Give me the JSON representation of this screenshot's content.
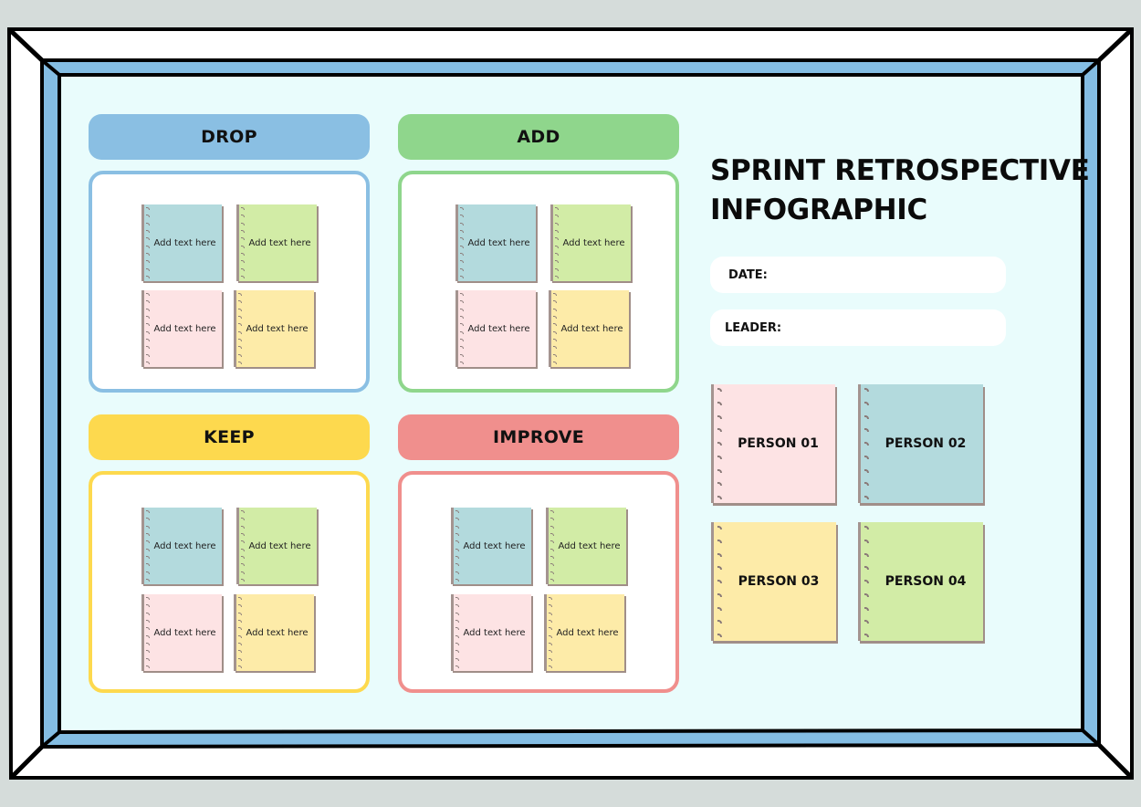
{
  "colors": {
    "background": "#d5dcda",
    "board": "#e9fcfc",
    "frame_blue": "#84bde3",
    "drop": "#8abfe3",
    "add": "#8fd68c",
    "keep": "#fdd94e",
    "improve": "#f08f8d"
  },
  "title": {
    "line1": "SPRINT RETROSPECTIVE",
    "line2": "INFOGRAPHIC"
  },
  "fields": {
    "date_label": "DATE:",
    "leader_label": "LEADER:"
  },
  "sections": [
    {
      "key": "drop",
      "label": "DROP",
      "notes": [
        "Add text here",
        "Add text here",
        "Add text here",
        "Add text here"
      ]
    },
    {
      "key": "add",
      "label": "ADD",
      "notes": [
        "Add text here",
        "Add text here",
        "Add text here",
        "Add text here"
      ]
    },
    {
      "key": "keep",
      "label": "KEEP",
      "notes": [
        "Add text here",
        "Add text here",
        "Add text here",
        "Add text here"
      ]
    },
    {
      "key": "improve",
      "label": "IMPROVE",
      "notes": [
        "Add text here",
        "Add text here",
        "Add text here",
        "Add text here"
      ]
    }
  ],
  "people": [
    "PERSON 01",
    "PERSON 02",
    "PERSON 03",
    "PERSON 04"
  ]
}
